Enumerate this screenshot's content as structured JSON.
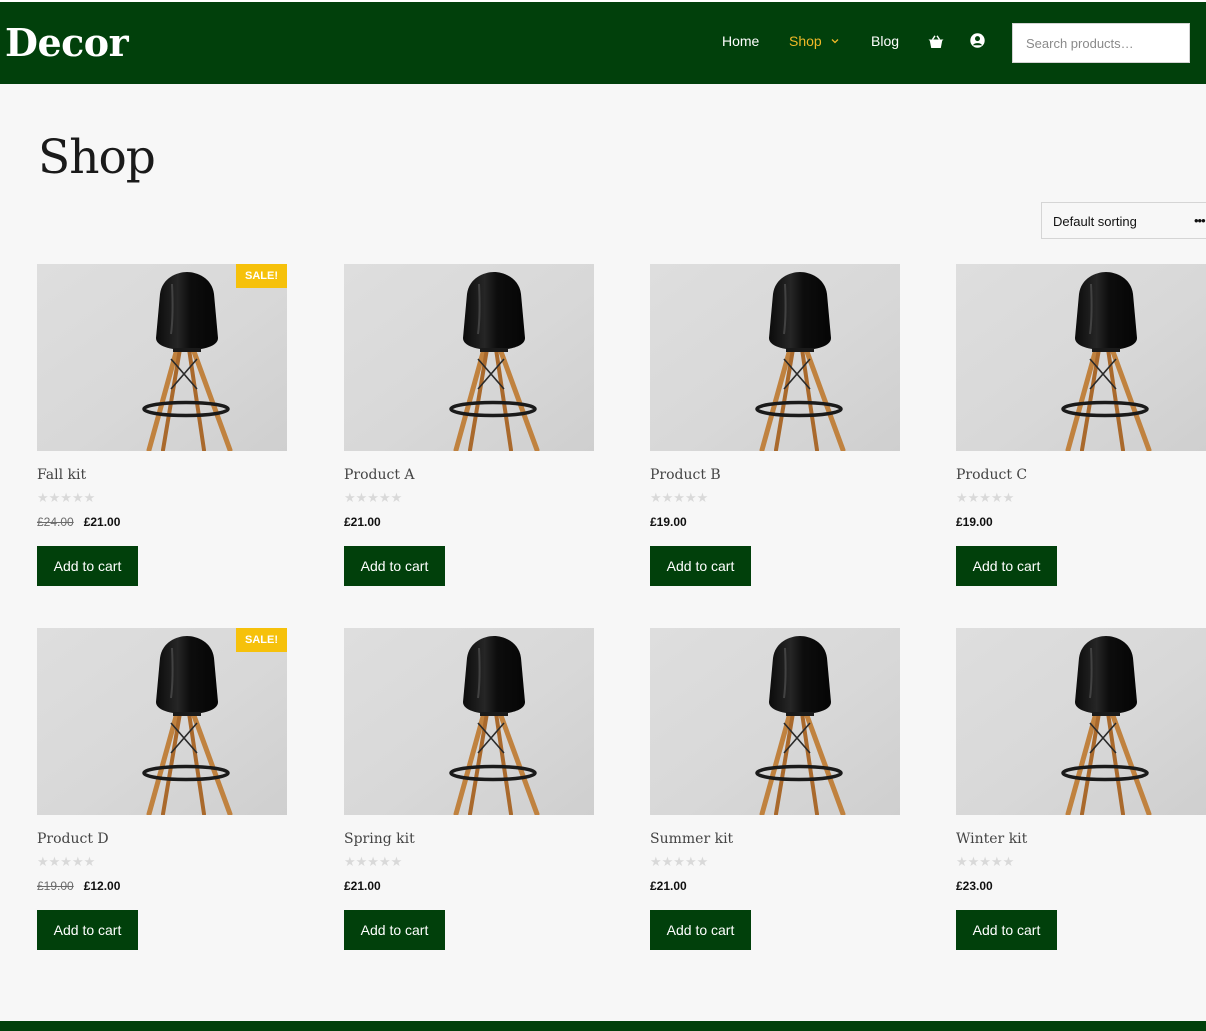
{
  "brand": {
    "logo": "Decor",
    "color": "#01400b",
    "accent": "#f0b928"
  },
  "nav": [
    {
      "label": "Home",
      "active": false
    },
    {
      "label": "Shop",
      "active": true,
      "has_dropdown": true
    },
    {
      "label": "Blog",
      "active": false
    }
  ],
  "header_icons": [
    "basket-icon",
    "user-icon"
  ],
  "search": {
    "placeholder": "Search products…",
    "value": ""
  },
  "page": {
    "title": "Shop"
  },
  "sorting": {
    "selected": "Default sorting"
  },
  "sale_badge": "SALE!",
  "products": [
    {
      "name": "Fall kit",
      "old_price": "£24.00",
      "price": "£21.00",
      "on_sale": true,
      "button": "Add to cart",
      "rating": "0/5"
    },
    {
      "name": "Product A",
      "old_price": "",
      "price": "£21.00",
      "on_sale": false,
      "button": "Add to cart",
      "rating": "0/5"
    },
    {
      "name": "Product B",
      "old_price": "",
      "price": "£19.00",
      "on_sale": false,
      "button": "Add to cart",
      "rating": "0/5"
    },
    {
      "name": "Product C",
      "old_price": "",
      "price": "£19.00",
      "on_sale": false,
      "button": "Add to cart",
      "rating": "0/5"
    },
    {
      "name": "Product D",
      "old_price": "£19.00",
      "price": "£12.00",
      "on_sale": true,
      "button": "Add to cart",
      "rating": "0/5"
    },
    {
      "name": "Spring kit",
      "old_price": "",
      "price": "£21.00",
      "on_sale": false,
      "button": "Add to cart",
      "rating": "0/5"
    },
    {
      "name": "Summer kit",
      "old_price": "",
      "price": "£21.00",
      "on_sale": false,
      "button": "Add to cart",
      "rating": "0/5"
    },
    {
      "name": "Winter kit",
      "old_price": "",
      "price": "£23.00",
      "on_sale": false,
      "button": "Add to cart",
      "rating": "0/5"
    }
  ]
}
